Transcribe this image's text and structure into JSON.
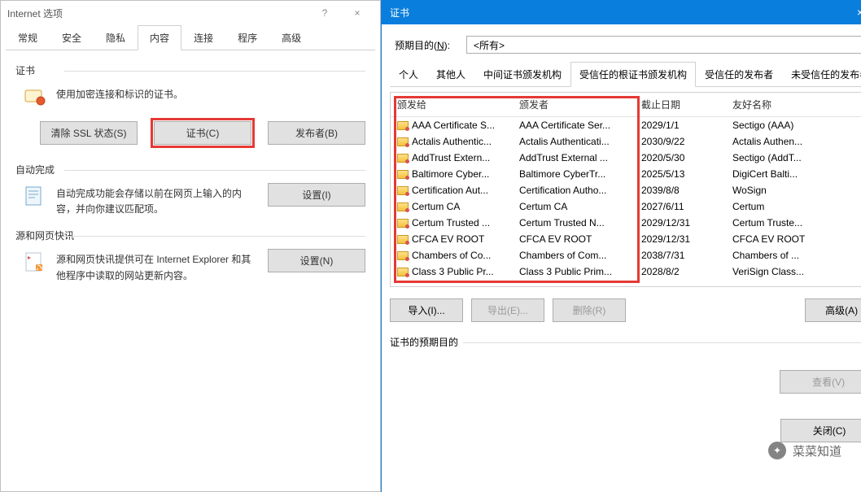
{
  "left": {
    "title": "Internet 选项",
    "help": "?",
    "close": "×",
    "tabs": [
      "常规",
      "安全",
      "隐私",
      "内容",
      "连接",
      "程序",
      "高级"
    ],
    "activeTab": 3,
    "cert": {
      "group": "证书",
      "desc": "使用加密连接和标识的证书。",
      "clearBtn": "清除 SSL 状态(S)",
      "certBtn": "证书(C)",
      "pubBtn": "发布者(B)"
    },
    "auto": {
      "group": "自动完成",
      "desc": "自动完成功能会存储以前在网页上输入的内容，并向你建议匹配项。",
      "btn": "设置(I)"
    },
    "feed": {
      "group": "源和网页快讯",
      "desc": "源和网页快讯提供可在 Internet Explorer 和其他程序中读取的网站更新内容。",
      "btn": "设置(N)"
    }
  },
  "right": {
    "title": "证书",
    "close": "×",
    "purposeLabelPre": "预期目的(",
    "purposeLabelU": "N",
    "purposeLabelPost": "):",
    "purposeValue": "<所有>",
    "tabs": [
      "个人",
      "其他人",
      "中间证书颁发机构",
      "受信任的根证书颁发机构",
      "受信任的发布者",
      "未受信任的发布者"
    ],
    "activeTab": 3,
    "headers": {
      "c1": "颁发给",
      "c2": "颁发者",
      "c3": "截止日期",
      "c4": "友好名称"
    },
    "rows": [
      {
        "to": "AAA Certificate S...",
        "by": "AAA Certificate Ser...",
        "date": "2029/1/1",
        "fn": "Sectigo (AAA)"
      },
      {
        "to": "Actalis Authentic...",
        "by": "Actalis Authenticati...",
        "date": "2030/9/22",
        "fn": "Actalis Authen..."
      },
      {
        "to": "AddTrust Extern...",
        "by": "AddTrust External ...",
        "date": "2020/5/30",
        "fn": "Sectigo (AddT..."
      },
      {
        "to": "Baltimore Cyber...",
        "by": "Baltimore CyberTr...",
        "date": "2025/5/13",
        "fn": "DigiCert Balti..."
      },
      {
        "to": "Certification Aut...",
        "by": "Certification Autho...",
        "date": "2039/8/8",
        "fn": "WoSign"
      },
      {
        "to": "Certum CA",
        "by": "Certum CA",
        "date": "2027/6/11",
        "fn": "Certum"
      },
      {
        "to": "Certum Trusted ...",
        "by": "Certum Trusted N...",
        "date": "2029/12/31",
        "fn": "Certum Truste..."
      },
      {
        "to": "CFCA EV ROOT",
        "by": "CFCA EV ROOT",
        "date": "2029/12/31",
        "fn": "CFCA EV ROOT"
      },
      {
        "to": "Chambers of Co...",
        "by": "Chambers of Com...",
        "date": "2038/7/31",
        "fn": "Chambers of ..."
      },
      {
        "to": "Class 3 Public Pr...",
        "by": "Class 3 Public Prim...",
        "date": "2028/8/2",
        "fn": "VeriSign Class..."
      }
    ],
    "actions": {
      "import": "导入(I)...",
      "export": "导出(E)...",
      "delete": "删除(R)",
      "advanced": "高级(A)"
    },
    "purposeSectionTitle": "证书的预期目的",
    "viewBtn": "查看(V)",
    "closeBtn": "关闭(C)"
  },
  "watermark": "菜菜知道"
}
